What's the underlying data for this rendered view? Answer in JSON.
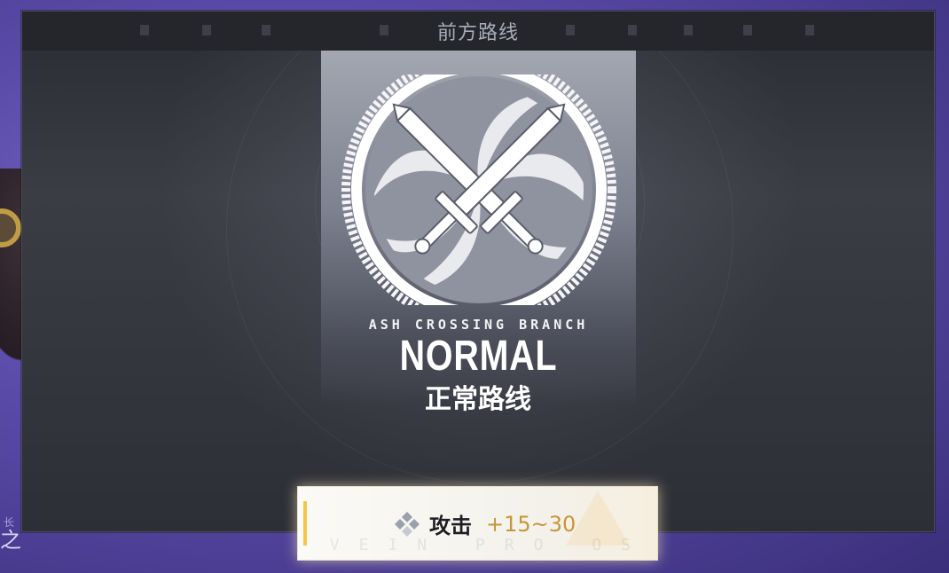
{
  "header": {
    "title": "前方路线"
  },
  "route": {
    "branch_label": "ASH CROSSING BRANCH",
    "type": "NORMAL",
    "name": "正常路线",
    "emblem_icon": "crossed-swords-icon"
  },
  "bonus": {
    "icon": "diamond-cluster-icon",
    "label": "攻击",
    "value": "+15~30",
    "watermark": "VEIN PRO OS"
  },
  "background": {
    "corner_text": "之",
    "side_mark": "长"
  },
  "colors": {
    "accent_gold": "#c99636",
    "bonus_bar": "#f2c64e",
    "title_text": "#a8adb8",
    "panel_bg": "#2d2f37"
  }
}
